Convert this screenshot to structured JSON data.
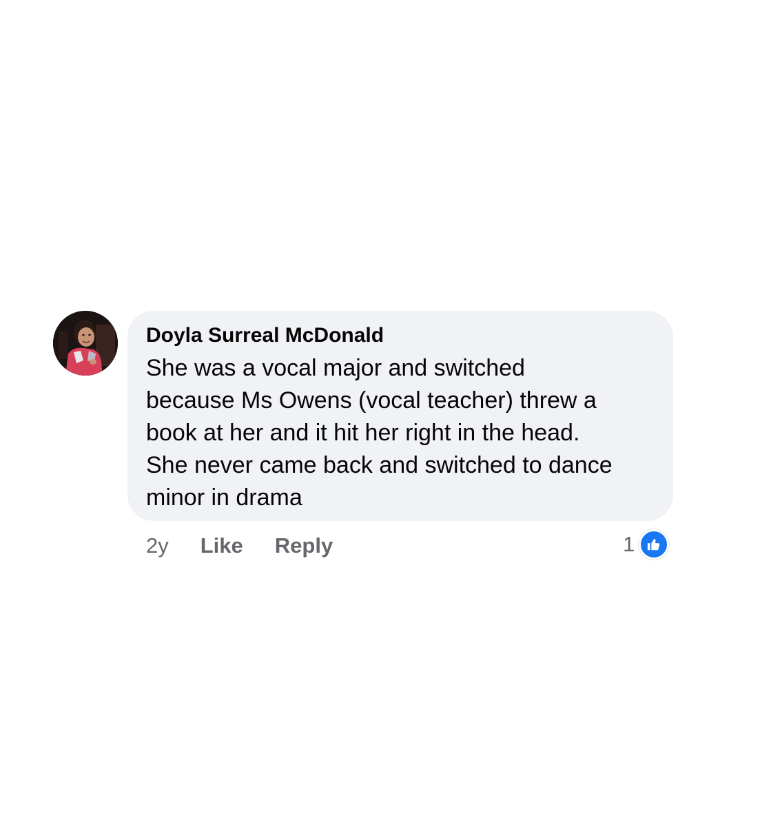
{
  "comment": {
    "author": "Doyla Surreal McDonald",
    "text_lines": [
      "She was a vocal major and switched",
      "because Ms Owens (vocal teacher) threw a",
      "book at her and it hit her right in the head.",
      "She never came back and switched to dance",
      "minor in drama"
    ],
    "avatar_icon": "profile-photo",
    "time": "2y",
    "like_label": "Like",
    "reply_label": "Reply",
    "reaction_count": "1",
    "reaction_icon": "thumbs-up-icon"
  },
  "colors": {
    "bubble_bg": "#f0f2f5",
    "meta_text": "#65676b",
    "reaction_blue": "#1877f2"
  }
}
